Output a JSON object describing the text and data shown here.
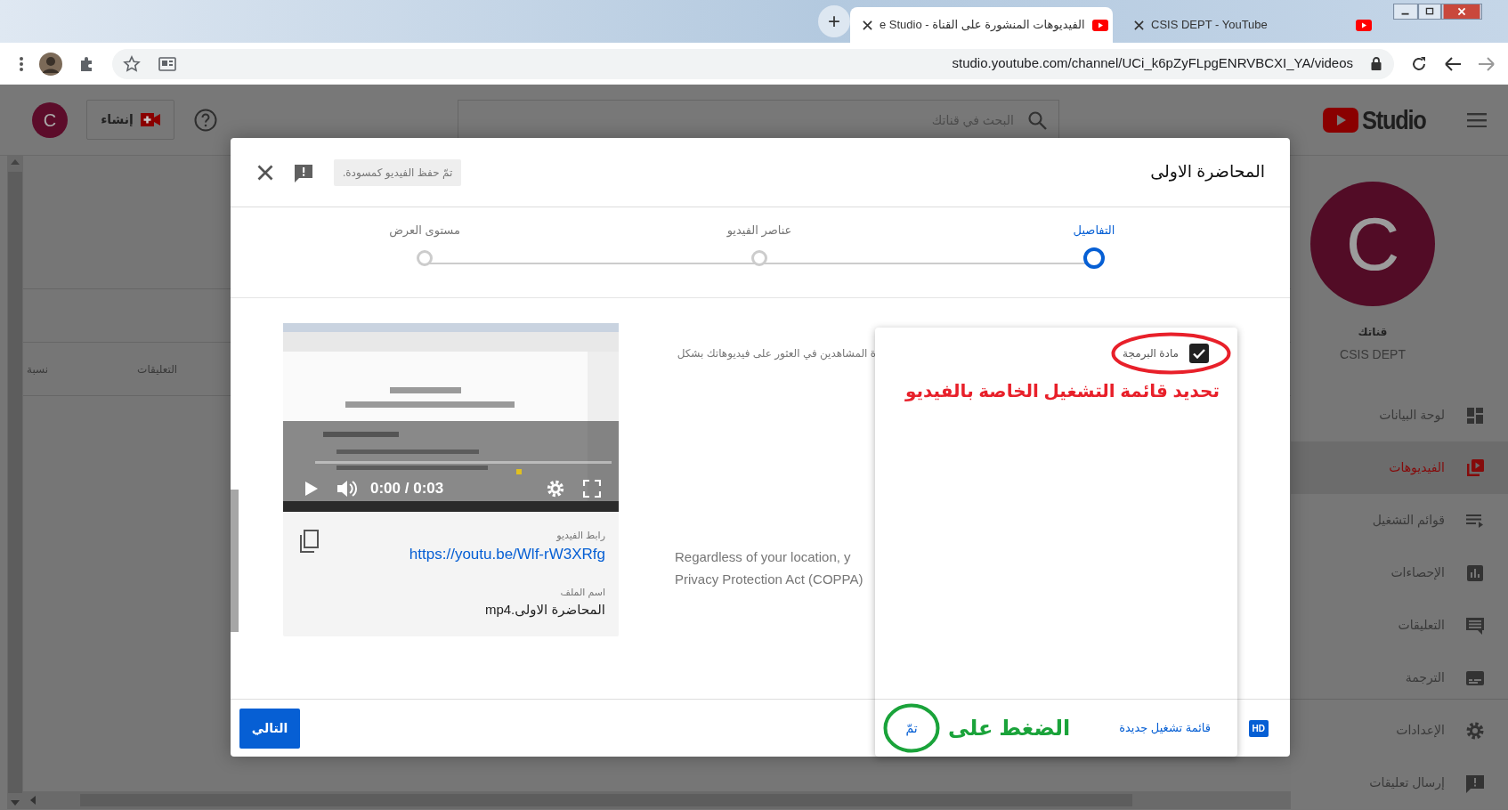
{
  "browser": {
    "new_tab": "+",
    "tabs": [
      {
        "title": "CSIS DEPT - YouTube",
        "selected": false
      },
      {
        "title": "الفيديوهات المنشورة على القناة - e Studio",
        "selected": true
      }
    ],
    "url": "studio.youtube.com/channel/UCi_k6pZyFLpgENRVBCXI_YA/videos"
  },
  "header": {
    "avatar": "C",
    "create": "إنشاء",
    "search_placeholder": "البحث في قناتك",
    "logo": "Studio"
  },
  "table": {
    "columns": [
      "التعليقات",
      "نسبة"
    ]
  },
  "sidebar": {
    "avatar": "C",
    "channel_label": "قناتك",
    "channel_name": "CSIS DEPT",
    "items": [
      {
        "label": "لوحة البيانات",
        "selected": false
      },
      {
        "label": "الفيديوهات",
        "selected": true
      },
      {
        "label": "قوائم التشغيل",
        "selected": false
      },
      {
        "label": "الإحصاءات",
        "selected": false
      },
      {
        "label": "التعليقات",
        "selected": false
      },
      {
        "label": "الترجمة",
        "selected": false
      }
    ],
    "footer_items": [
      {
        "label": "الإعدادات"
      },
      {
        "label": "إرسال تعليقات"
      }
    ]
  },
  "dialog": {
    "title": "المحاضرة الاولى",
    "saved_note": "تمّ حفظ الفيديو كمسودة.",
    "steps": [
      {
        "label": "التفاصيل",
        "selected": true
      },
      {
        "label": "عناصر الفيديو",
        "selected": false
      },
      {
        "label": "مستوى العرض",
        "selected": false
      }
    ],
    "description": "ة المشاهدين في العثور على فيديوهاتك بشكل",
    "coppa": [
      "Regardless of your location, y",
      "Privacy Protection Act (COPPA)"
    ],
    "video": {
      "level": 0,
      "time": "0:00 / 0:03",
      "link_label": "رابط الفيديو",
      "link": "https://youtu.be/Wlf-rW3XRfg",
      "filename_label": "اسم الملف",
      "filename": "المحاضرة الاولى.mp4"
    },
    "playlist_popup": {
      "playlists": [
        {
          "label": "مادة البرمجة",
          "checked": true
        }
      ],
      "new_playlist": "قائمة تشغيل جديدة",
      "done": "تمّ"
    },
    "quality_badge": "HD",
    "next": "التالي"
  },
  "annotations": [
    {
      "kind": "ellipse",
      "color": "#e8202a"
    },
    {
      "kind": "text",
      "text": "تحديد قائمة التشغيل الخاصة بالفيديو",
      "color": "#e8202a"
    },
    {
      "kind": "text",
      "text": "الضغط على",
      "color": "#1aa33a"
    },
    {
      "kind": "ellipse",
      "color": "#1aa33a"
    }
  ]
}
